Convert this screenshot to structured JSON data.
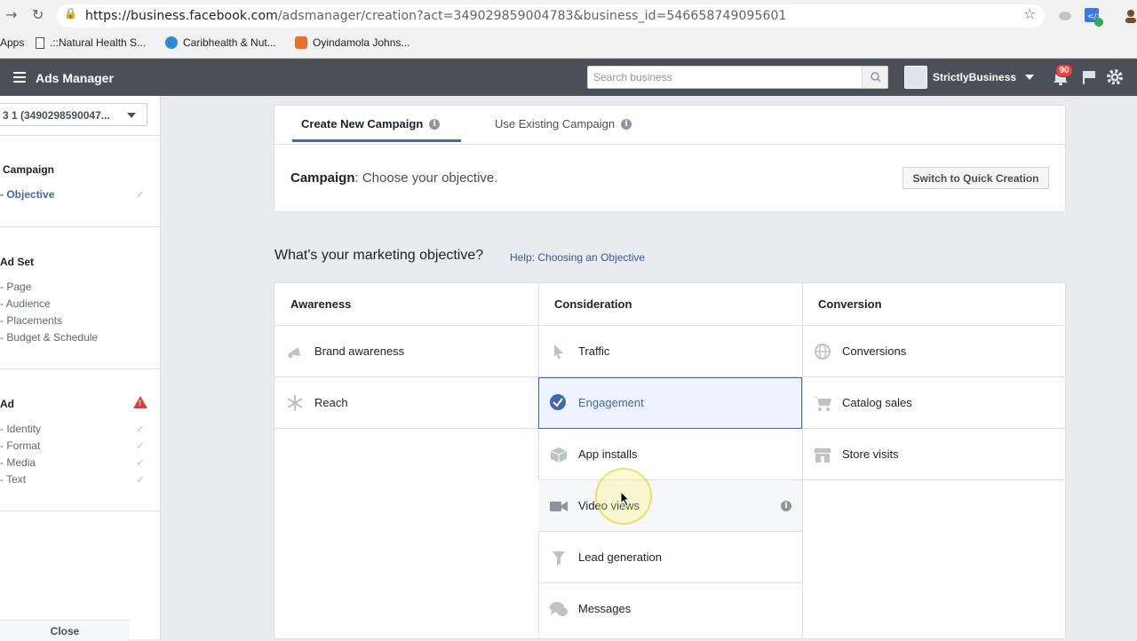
{
  "browser": {
    "url_host": "https://business.facebook.com",
    "url_path": "/adsmanager/creation?act=349029859004783&business_id=546658749095601",
    "bookmarks": [
      "Apps",
      ".::Natural Health S...",
      "Caribhealth & Nut...",
      "Oyindamola Johns..."
    ]
  },
  "topbar": {
    "title": "Ads Manager",
    "search_placeholder": "Search business",
    "account_name": "StrictlyBusiness",
    "notification_count": "90"
  },
  "sidebar": {
    "campaign_select": "3 1 (3490298590047...",
    "campaign_header": "Campaign",
    "campaign_items": [
      {
        "label": "Objective",
        "checked": true
      }
    ],
    "adset_header": "Ad Set",
    "adset_items": [
      "Page",
      "Audience",
      "Placements",
      "Budget & Schedule"
    ],
    "ad_header": "Ad",
    "ad_items": [
      "Identity",
      "Format",
      "Media",
      "Text"
    ],
    "close_label": "Close"
  },
  "main": {
    "tabs": [
      "Create New Campaign",
      "Use Existing Campaign"
    ],
    "campaign_label": "Campaign",
    "campaign_text": ": Choose your objective.",
    "quick_creation_label": "Switch to Quick Creation",
    "objective_question": "What's your marketing objective?",
    "help_link": "Help: Choosing an Objective",
    "columns": [
      {
        "header": "Awareness",
        "options": [
          "Brand awareness",
          "Reach"
        ]
      },
      {
        "header": "Consideration",
        "options": [
          "Traffic",
          "Engagement",
          "App installs",
          "Video views",
          "Lead generation",
          "Messages"
        ]
      },
      {
        "header": "Conversion",
        "options": [
          "Conversions",
          "Catalog sales",
          "Store visits"
        ]
      }
    ],
    "selected_option": "Engagement"
  },
  "colors": {
    "accent": "#4267b2",
    "topbar": "#4b4f56",
    "selected_bg": "#edf4ff",
    "warning": "#d93f33"
  }
}
